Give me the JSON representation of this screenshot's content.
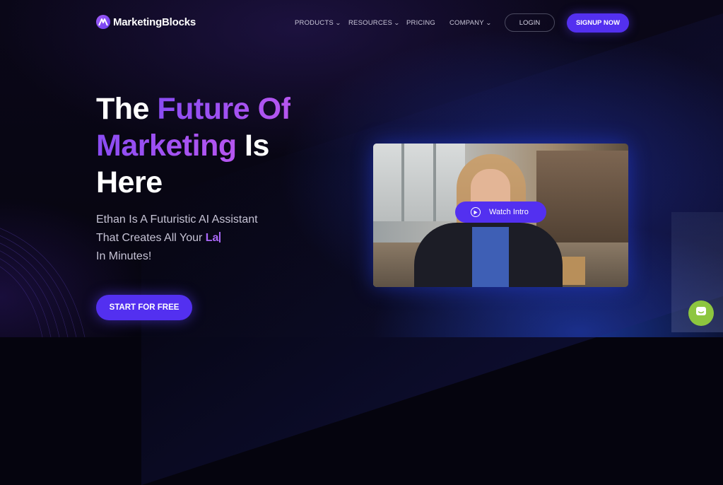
{
  "brand": {
    "name": "MarketingBlocks",
    "accent": "#5330f0",
    "gradient": [
      "#8a4cf3",
      "#b656f0"
    ]
  },
  "nav": {
    "products": "PRODUCTS",
    "resources": "RESOURCES",
    "pricing": "PRICING",
    "company": "COMPANY",
    "login": "LOGIN",
    "signup": "SIGNUP NOW"
  },
  "hero": {
    "headline_1": "The ",
    "headline_2": "Future Of",
    "headline_3": "Marketing",
    "headline_4": " Is",
    "headline_5": "Here",
    "sub_1": "Ethan Is A Futuristic AI Assistant",
    "sub_2": "That Creates All Your ",
    "sub_typed": "La",
    "sub_3": "In Minutes!",
    "cta": "START FOR FREE"
  },
  "video": {
    "button": "Watch Intro",
    "icon": "play-icon"
  },
  "chat": {
    "icon": "chat-icon",
    "color": "#8dc63f"
  }
}
